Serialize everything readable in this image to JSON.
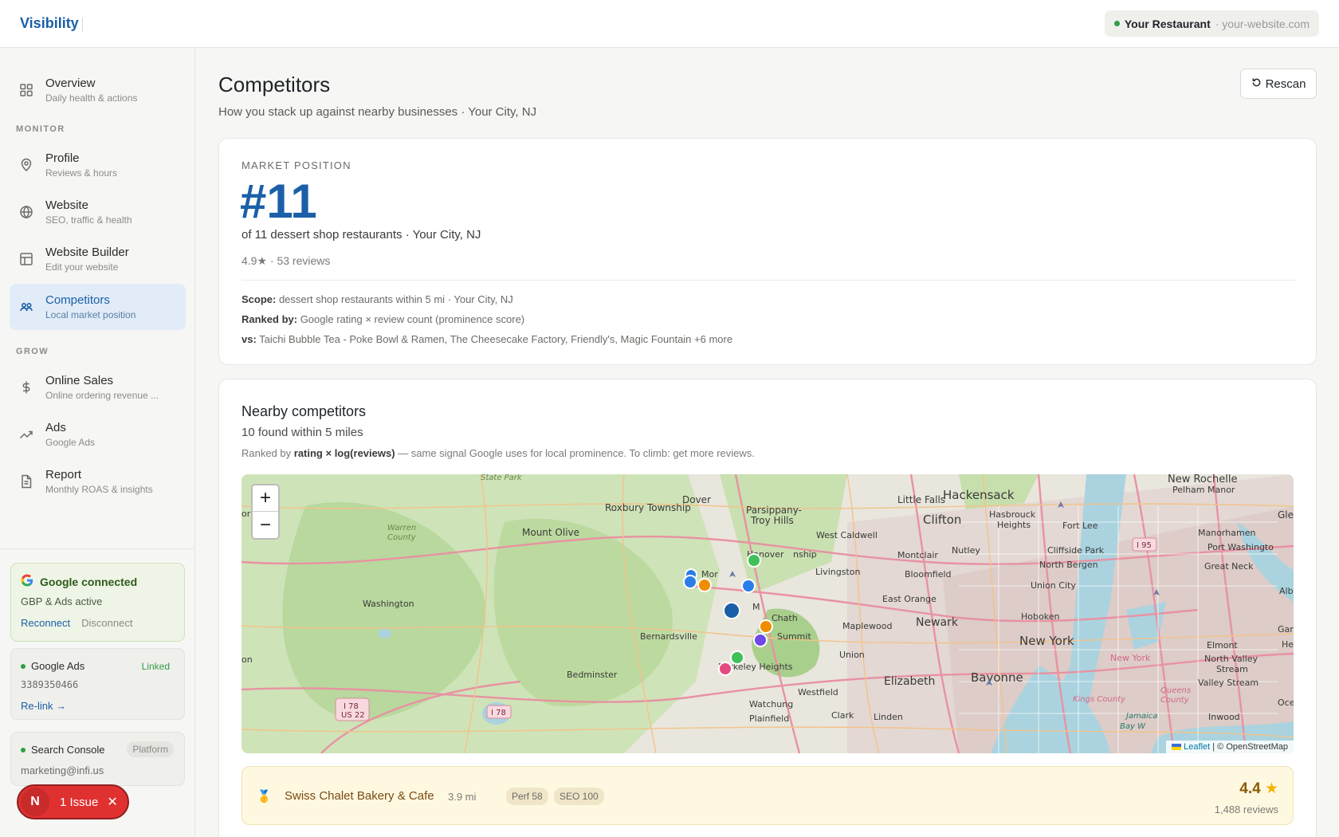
{
  "header": {
    "brand": "Visibility",
    "restaurant_name": "Your Restaurant",
    "website": "· your-website.com"
  },
  "sidebar": {
    "overview": {
      "title": "Overview",
      "sub": "Daily health & actions"
    },
    "monitor_label": "MONITOR",
    "monitor_items": [
      {
        "title": "Profile",
        "sub": "Reviews & hours",
        "icon": "map-pin-icon"
      },
      {
        "title": "Website",
        "sub": "SEO, traffic & health",
        "icon": "globe-icon"
      },
      {
        "title": "Website Builder",
        "sub": "Edit your website",
        "icon": "layout-icon"
      },
      {
        "title": "Competitors",
        "sub": "Local market position",
        "icon": "users-icon",
        "active": true
      }
    ],
    "grow_label": "GROW",
    "grow_items": [
      {
        "title": "Online Sales",
        "sub": "Online ordering revenue ...",
        "icon": "dollar-icon"
      },
      {
        "title": "Ads",
        "sub": "Google Ads",
        "icon": "trending-up-icon"
      },
      {
        "title": "Report",
        "sub": "Monthly ROAS & insights",
        "icon": "document-icon"
      }
    ],
    "google_card": {
      "title": "Google connected",
      "sub": "GBP & Ads active",
      "reconnect": "Reconnect",
      "disconnect": "Disconnect"
    },
    "ads_card": {
      "title": "Google Ads",
      "badge": "Linked",
      "account": "3389350466",
      "relink": "Re-link →"
    },
    "console_card": {
      "title": "Search Console",
      "badge": "Platform",
      "email": "marketing@infi.us"
    },
    "issue": {
      "avatar": "N",
      "label": "1 Issue"
    }
  },
  "main": {
    "title": "Competitors",
    "subtitle": "How you stack up against nearby businesses · Your City, NJ",
    "rescan": "Rescan",
    "market": {
      "label": "MARKET POSITION",
      "rank": "#11",
      "of": "of 11 dessert shop restaurants · Your City, NJ",
      "rating": "4.9★ · 53 reviews",
      "scope_label": "Scope:",
      "scope": " dessert shop restaurants within 5 mi · Your City, NJ",
      "ranked_label": "Ranked by:",
      "ranked": " Google rating × review count (prominence score)",
      "vs_label": "vs:",
      "vs": " Taichi Bubble Tea - Poke Bowl & Ramen, The Cheesecake Factory, Friendly's, Magic Fountain +6 more"
    },
    "nearby": {
      "title": "Nearby competitors",
      "sub": "10 found within 5 miles",
      "note_prefix": "Ranked by ",
      "note_bold": "rating × log(reviews)",
      "note_suffix": " — same signal Google uses for local prominence. To climb: get more reviews."
    },
    "map": {
      "zoom_in": "+",
      "zoom_out": "−",
      "attribution_leaflet": "Leaflet",
      "attribution_rest": " | © OpenStreetMap",
      "labels": [
        "Dover",
        "Roxbury Township",
        "Mount Olive",
        "Parsippany-",
        "Troy Hills",
        "Little Falls",
        "Clifton",
        "Hackensack",
        "Hasbrouck",
        "Heights",
        "Fort Lee",
        "West Caldwell",
        "Hanover",
        "nship",
        "Montclair",
        "Nutley",
        "Cliffside Park",
        "North Bergen",
        "Union City",
        "Bloomfield",
        "Livingston",
        "East Orange",
        "Newark",
        "Hoboken",
        "New York",
        "Maplewood",
        "Chath",
        "Summit",
        "Washington",
        "Bernardsville",
        "Berkeley Heights",
        "Bedminster",
        "Union",
        "Elizabeth",
        "Bayonne",
        "Westfield",
        "Watchung",
        "Plainfield",
        "Clark",
        "Linden",
        "Manorhamen",
        "Port Washingto",
        "Great Neck",
        "Elmont",
        "North Valley",
        "Stream",
        "Valley Stream",
        "Inwood",
        "New Rochelle",
        "Pelham Manor",
        "Warren",
        "County",
        "State Park",
        "I 78",
        "US 22",
        "I 95",
        "Mor",
        "M",
        "New York",
        "Kings County",
        "Queens",
        "County",
        "Jamaica",
        "Bay W",
        "Gle",
        "Albe",
        "Garc",
        "He",
        "Ocea",
        "on",
        "or"
      ],
      "markers": [
        {
          "color": "#1b5fa8",
          "label": "Your Restaurant"
        },
        {
          "color": "#2b7de9"
        },
        {
          "color": "#2b7de9"
        },
        {
          "color": "#2b7de9"
        },
        {
          "color": "#f08c00"
        },
        {
          "color": "#f08c00"
        },
        {
          "color": "#40c057"
        },
        {
          "color": "#40c057"
        },
        {
          "color": "#7048e8"
        },
        {
          "color": "#e64980"
        },
        {
          "color": "#2b7de9"
        }
      ]
    },
    "top_competitor": {
      "medal": "🥇",
      "name": "Swiss Chalet Bakery & Cafe",
      "distance": "3.9 mi",
      "perf": "Perf 58",
      "seo": "SEO 100",
      "rating": "4.4",
      "reviews": "1,488 reviews"
    }
  }
}
